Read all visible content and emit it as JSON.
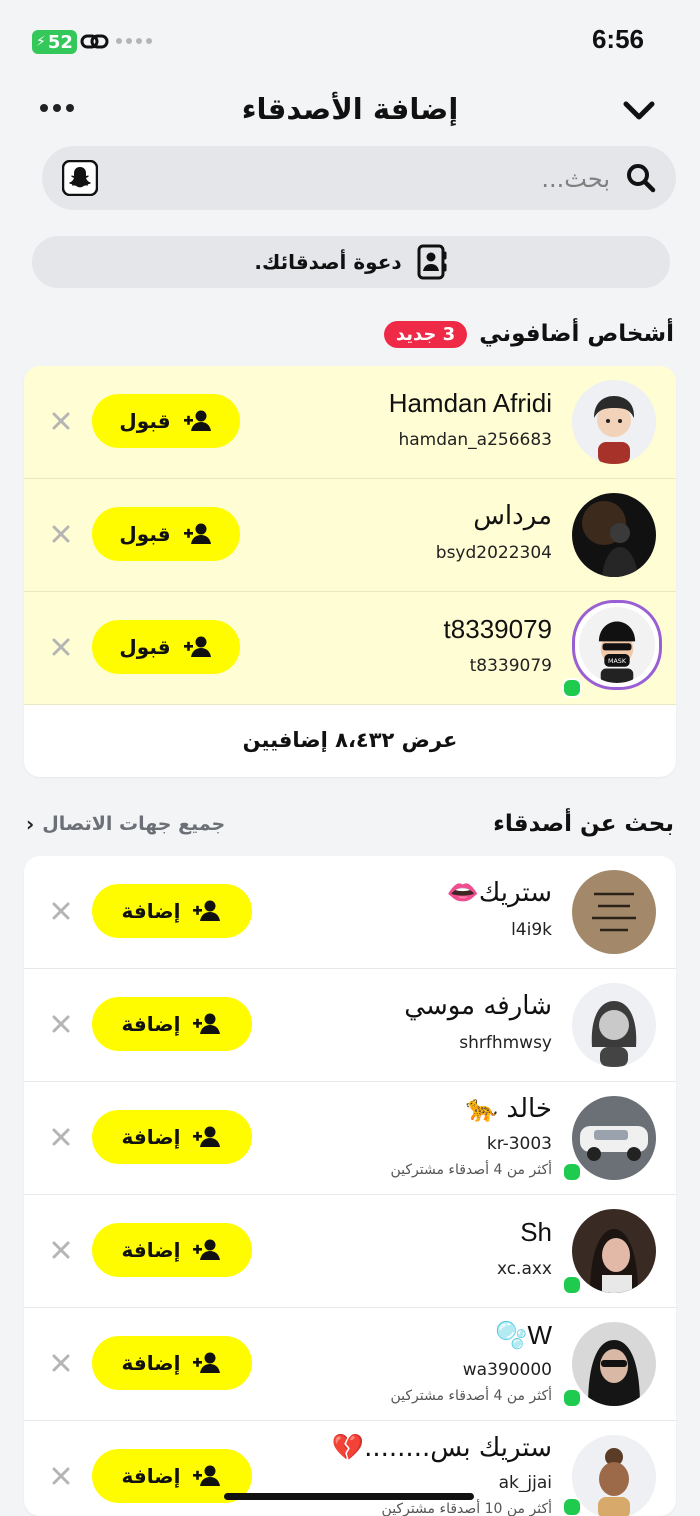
{
  "status": {
    "battery": "52",
    "time": "6:56"
  },
  "header": {
    "title": "إضافة الأصدقاء"
  },
  "search": {
    "placeholder": "بحث..."
  },
  "invite": {
    "label": "دعوة أصدقائك."
  },
  "requests": {
    "title": "أشخاص أضافوني",
    "badge": "3 جديد",
    "accept_label": "قبول",
    "items": [
      {
        "name": "Hamdan Afridi",
        "username": "hamdan_a256683"
      },
      {
        "name": "مرداس",
        "username": "bsyd2022304"
      },
      {
        "name": "t8339079",
        "username": "t8339079"
      }
    ],
    "view_more": "عرض ٨،٤٣٢ إضافيين"
  },
  "find": {
    "title": "بحث عن أصدقاء",
    "contacts_link": "جميع جهات الاتصال",
    "add_label": "إضافة",
    "items": [
      {
        "name": "ستريك👄",
        "username": "l4i9k",
        "mutual": ""
      },
      {
        "name": "شارفه موسي",
        "username": "shrfhmwsy",
        "mutual": ""
      },
      {
        "name": "خالد 🐆",
        "username": "kr-3003",
        "mutual": "أكثر من 4 أصدقاء مشتركين"
      },
      {
        "name": "Sh",
        "username": "xc.axx",
        "mutual": ""
      },
      {
        "name": "W🫧",
        "username": "wa390000",
        "mutual": "أكثر من 4 أصدقاء مشتركين"
      },
      {
        "name": "ستريك بس........💔",
        "username": "ak_jjai",
        "mutual": "أكثر من 10 أصدقاء مشتركين"
      }
    ]
  },
  "colors": {
    "accent": "#fffc00",
    "badge": "#ef2a47",
    "online": "#1ecb4f"
  }
}
